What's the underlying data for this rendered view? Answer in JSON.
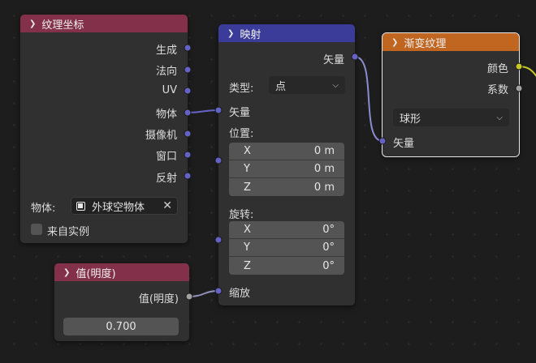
{
  "colors": {
    "vector_socket": "#6363c7",
    "color_socket": "#c7c729",
    "float_socket": "#a1a1a1",
    "input_header": "#83314a",
    "vector_header": "#3b3b9a",
    "texture_header": "#c06621"
  },
  "texcoord": {
    "title": "纹理坐标",
    "outputs": [
      "生成",
      "法向",
      "UV",
      "物体",
      "摄像机",
      "窗口",
      "反射"
    ],
    "object_label": "物体:",
    "object_value": "外球空物体",
    "from_instancer": "来自实例"
  },
  "mapping": {
    "title": "映射",
    "output_vector": "矢量",
    "type_label": "类型:",
    "type_value": "点",
    "input_vector": "矢量",
    "location_label": "位置:",
    "location": [
      {
        "axis": "X",
        "value": "0 m"
      },
      {
        "axis": "Y",
        "value": "0 m"
      },
      {
        "axis": "Z",
        "value": "0 m"
      }
    ],
    "rotation_label": "旋转:",
    "rotation": [
      {
        "axis": "X",
        "value": "0°"
      },
      {
        "axis": "Y",
        "value": "0°"
      },
      {
        "axis": "Z",
        "value": "0°"
      }
    ],
    "scale_label": "缩放"
  },
  "value_node": {
    "title": "值(明度)",
    "output": "值(明度)",
    "value": "0.700"
  },
  "gradient": {
    "title": "渐变纹理",
    "output_color": "颜色",
    "output_factor": "系数",
    "type_value": "球形",
    "input_vector": "矢量"
  }
}
